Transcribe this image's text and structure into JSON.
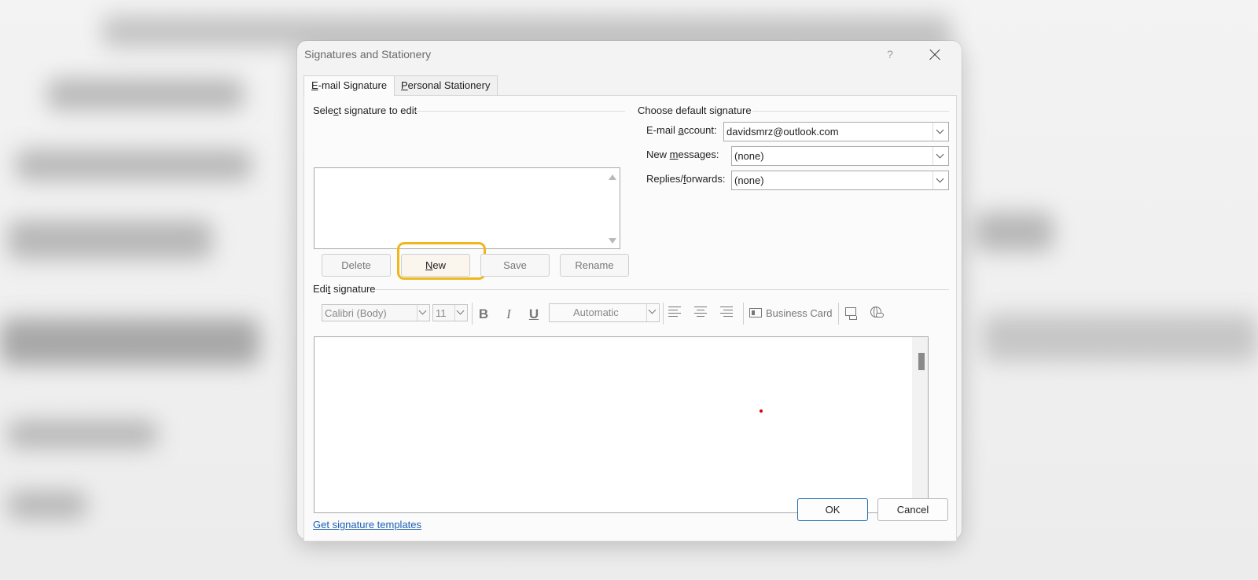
{
  "dialog": {
    "title": "Signatures and Stationery",
    "help": "?",
    "tabs": [
      {
        "pre": "",
        "u": "E",
        "post": "-mail Signature"
      },
      {
        "pre": "",
        "u": "P",
        "post": "ersonal Stationery"
      }
    ]
  },
  "select_section": {
    "label_pre": "Sele",
    "label_u": "c",
    "label_post": "t signature to edit",
    "buttons": {
      "delete": "Delete",
      "new_u": "N",
      "new_post": "ew",
      "save": "Save",
      "rename": "Rename"
    }
  },
  "default_section": {
    "label": "Choose default signature",
    "email_account_pre": "E-mail ",
    "email_account_u": "a",
    "email_account_post": "ccount:",
    "email_account_value": "davidsmrz@outlook.com",
    "new_messages_pre": "New ",
    "new_messages_u": "m",
    "new_messages_post": "essages:",
    "new_messages_value": "(none)",
    "replies_pre": "Replies/",
    "replies_u": "f",
    "replies_post": "orwards:",
    "replies_value": "(none)"
  },
  "edit_section": {
    "label_pre": "Edi",
    "label_u": "t",
    "label_post": " signature",
    "font": "Calibri (Body)",
    "size": "11",
    "bold": "B",
    "italic": "I",
    "underline": "U",
    "color": "Automatic",
    "business_card": "Business Card"
  },
  "footer": {
    "templates_link": "Get signature templates",
    "ok": "OK",
    "cancel": "Cancel"
  },
  "colors": {
    "highlight": "#f0b71c",
    "link": "#1a5fb4"
  }
}
